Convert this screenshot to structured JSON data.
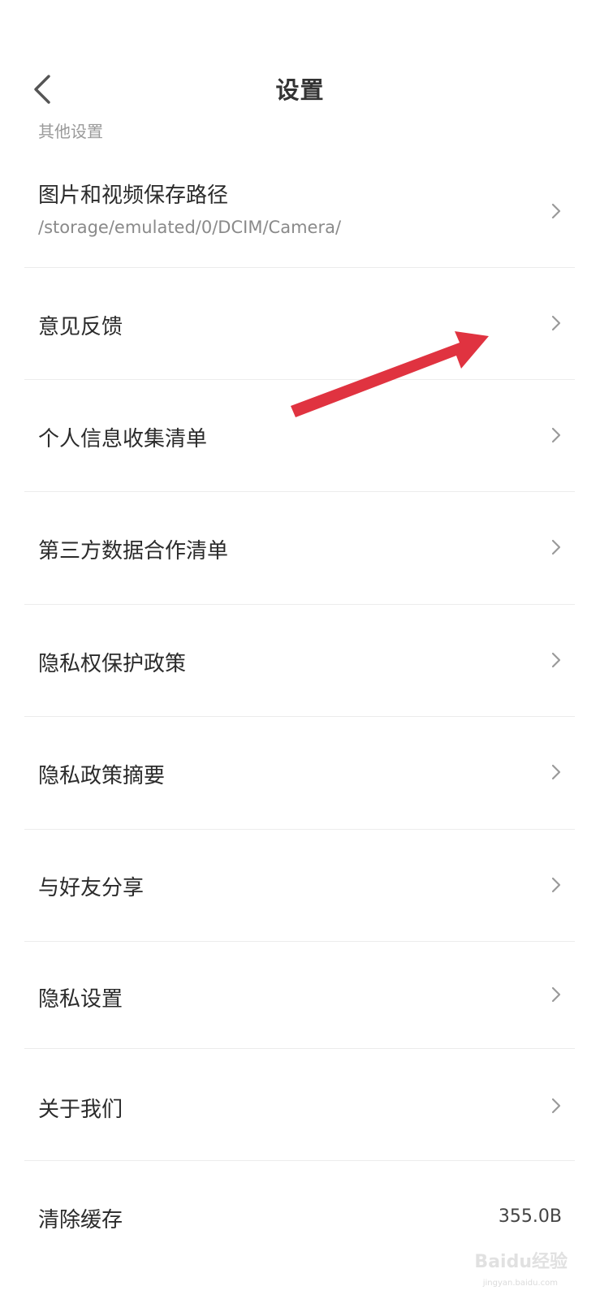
{
  "header": {
    "title": "设置",
    "back_icon": "chevron-left-icon"
  },
  "section": {
    "label": "其他设置"
  },
  "items": [
    {
      "label": "图片和视频保存路径",
      "sub": "/storage/emulated/0/DCIM/Camera/",
      "icon": "chevron-right-icon"
    },
    {
      "label": "意见反馈",
      "icon": "chevron-right-icon"
    },
    {
      "label": "个人信息收集清单",
      "icon": "chevron-right-icon"
    },
    {
      "label": "第三方数据合作清单",
      "icon": "chevron-right-icon"
    },
    {
      "label": "隐私权保护政策",
      "icon": "chevron-right-icon"
    },
    {
      "label": "隐私政策摘要",
      "icon": "chevron-right-icon"
    },
    {
      "label": "与好友分享",
      "icon": "chevron-right-icon"
    },
    {
      "label": "隐私设置",
      "icon": "chevron-right-icon"
    },
    {
      "label": "关于我们",
      "icon": "chevron-right-icon"
    },
    {
      "label": "清除缓存",
      "value": "355.0B"
    }
  ],
  "annotation": {
    "arrow_color": "#e03340"
  },
  "watermark": {
    "text": "Baidu经验",
    "sub": "jingyan.baidu.com"
  }
}
